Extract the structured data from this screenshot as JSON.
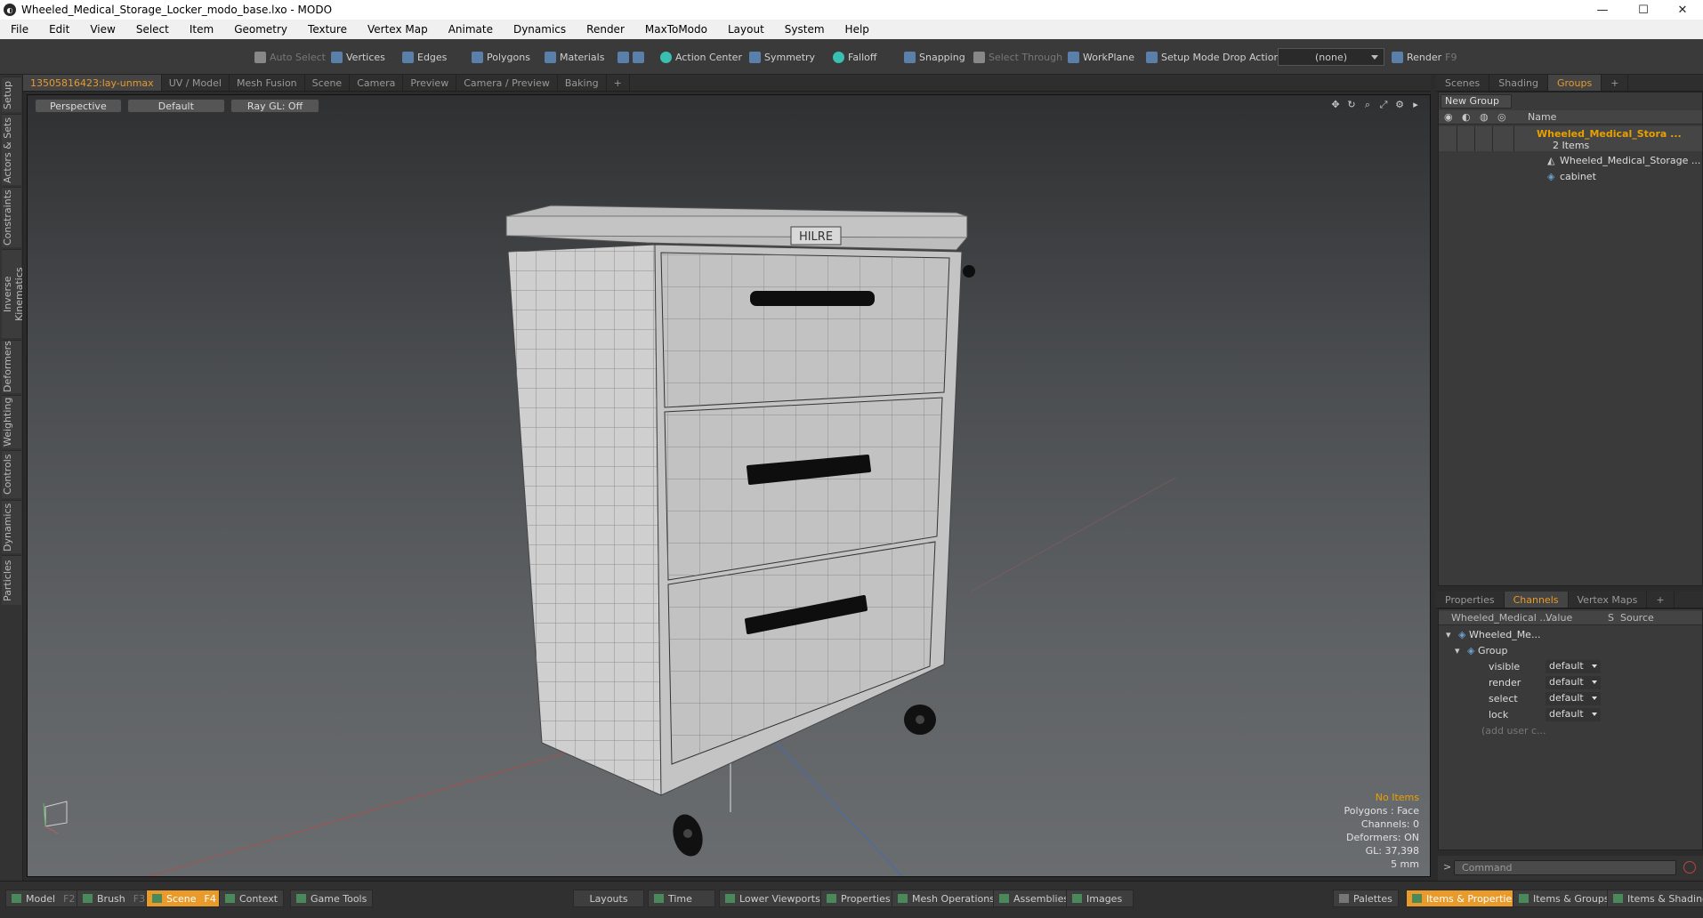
{
  "window": {
    "title": "Wheeled_Medical_Storage_Locker_modo_base.lxo - MODO",
    "logo_glyph": "◐",
    "minimize": "—",
    "maximize": "☐",
    "close": "✕"
  },
  "menu": [
    "File",
    "Edit",
    "View",
    "Select",
    "Item",
    "Geometry",
    "Texture",
    "Vertex Map",
    "Animate",
    "Dynamics",
    "Render",
    "MaxToModo",
    "Layout",
    "System",
    "Help"
  ],
  "toolbar": {
    "auto_select": "Auto Select",
    "vertices": "Vertices",
    "edges": "Edges",
    "polygons": "Polygons",
    "materials": "Materials",
    "action_center": "Action Center",
    "symmetry": "Symmetry",
    "falloff": "Falloff",
    "snapping": "Snapping",
    "select_through": "Select Through",
    "workplane": "WorkPlane",
    "setup_mode": "Setup Mode",
    "drop_action": "Drop Action",
    "drop_value": "(none)",
    "render": "Render",
    "render_key": "F9"
  },
  "left_tabs": [
    "Setup",
    "Actors & Sets",
    "Constraints",
    "Inverse Kinematics",
    "Deformers",
    "Weighting",
    "Controls",
    "Dynamics",
    "Particles"
  ],
  "viewport_tabs": [
    "13505816423:lay-unmax",
    "UV / Model",
    "Mesh Fusion",
    "Scene",
    "Camera",
    "Preview",
    "Camera / Preview",
    "Baking",
    "+"
  ],
  "viewport": {
    "view": "Perspective",
    "shading": "Default",
    "raygl": "Ray GL: Off",
    "logo": "HILRE",
    "stats": {
      "selection": "No Items",
      "polygons": "Polygons : Face",
      "channels": "Channels: 0",
      "deformers": "Deformers: ON",
      "gl": "GL: 37,398",
      "unit": "5 mm"
    }
  },
  "scene_tabs": [
    "Scenes",
    "Shading",
    "Groups",
    "+"
  ],
  "groups": {
    "new_group": "New Group",
    "col_name": "Name",
    "root": "Wheeled_Medical_Stora ...",
    "root_count": "2 Items",
    "children": [
      "Wheeled_Medical_Storage ...",
      "cabinet"
    ]
  },
  "prop_tabs": [
    "Properties",
    "Channels",
    "Vertex Maps",
    "+"
  ],
  "channels": {
    "head_item": "Wheeled_Medical ...",
    "head_value": "Value",
    "head_s": "S",
    "head_source": "Source",
    "item": "Wheeled_Me...",
    "group": "Group",
    "rows": [
      {
        "name": "visible",
        "value": "default"
      },
      {
        "name": "render",
        "value": "default"
      },
      {
        "name": "select",
        "value": "default"
      },
      {
        "name": "lock",
        "value": "default"
      }
    ],
    "add_user": "(add user c..."
  },
  "command": {
    "prompt": ">",
    "placeholder": "Command"
  },
  "bottom": {
    "model": "Model",
    "model_key": "F2",
    "brush": "Brush",
    "brush_key": "F3",
    "scene": "Scene",
    "scene_key": "F4",
    "context": "Context",
    "game_tools": "Game Tools",
    "layouts": "Layouts",
    "time": "Time",
    "lower_viewports": "Lower Viewports",
    "properties": "Properties",
    "mesh_operations": "Mesh Operations",
    "assemblies": "Assemblies",
    "images": "Images",
    "palettes": "Palettes",
    "items_properties": "Items & Properties",
    "items_groups": "Items & Groups",
    "items_shading": "Items & Shading"
  },
  "colors": {
    "accent": "#e89a2a",
    "highlight_text": "#e8a000"
  }
}
